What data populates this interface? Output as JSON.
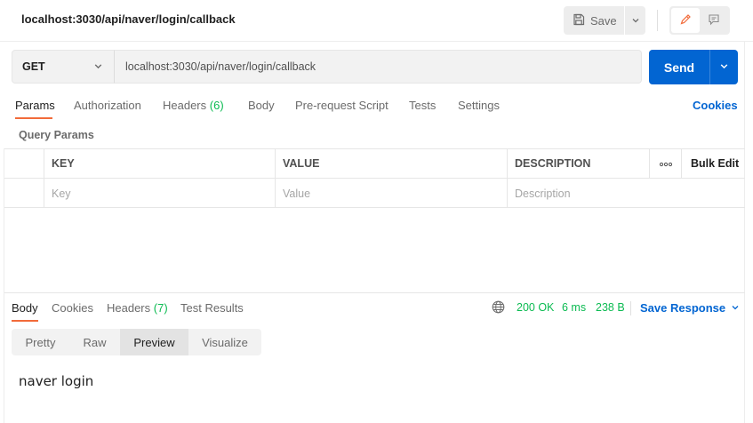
{
  "header": {
    "title": "localhost:3030/api/naver/login/callback",
    "save_label": "Save"
  },
  "request": {
    "method": "GET",
    "url": "localhost:3030/api/naver/login/callback",
    "send_label": "Send"
  },
  "request_tabs": {
    "params": "Params",
    "authorization": "Authorization",
    "headers": "Headers",
    "headers_count": "(6)",
    "body": "Body",
    "pre_request": "Pre-request Script",
    "tests": "Tests",
    "settings": "Settings",
    "cookies": "Cookies"
  },
  "query_params": {
    "label": "Query Params",
    "columns": {
      "key": "KEY",
      "value": "VALUE",
      "description": "DESCRIPTION",
      "bulk_edit": "Bulk Edit"
    },
    "placeholders": {
      "key": "Key",
      "value": "Value",
      "description": "Description"
    }
  },
  "response_tabs": {
    "body": "Body",
    "cookies": "Cookies",
    "headers": "Headers",
    "headers_count": "(7)",
    "test_results": "Test Results"
  },
  "response_status": {
    "status": "200 OK",
    "time": "6 ms",
    "size": "238 B",
    "save_response": "Save Response"
  },
  "view_modes": {
    "pretty": "Pretty",
    "raw": "Raw",
    "preview": "Preview",
    "visualize": "Visualize",
    "active": "Preview"
  },
  "response_body": "naver login",
  "colors": {
    "accent": "#0265d2",
    "active_tab": "#f26b3a",
    "success": "#0cbb52"
  },
  "icons": [
    "save-icon",
    "chevron-down-icon",
    "pencil-icon",
    "comment-icon",
    "more-icon",
    "globe-icon"
  ]
}
